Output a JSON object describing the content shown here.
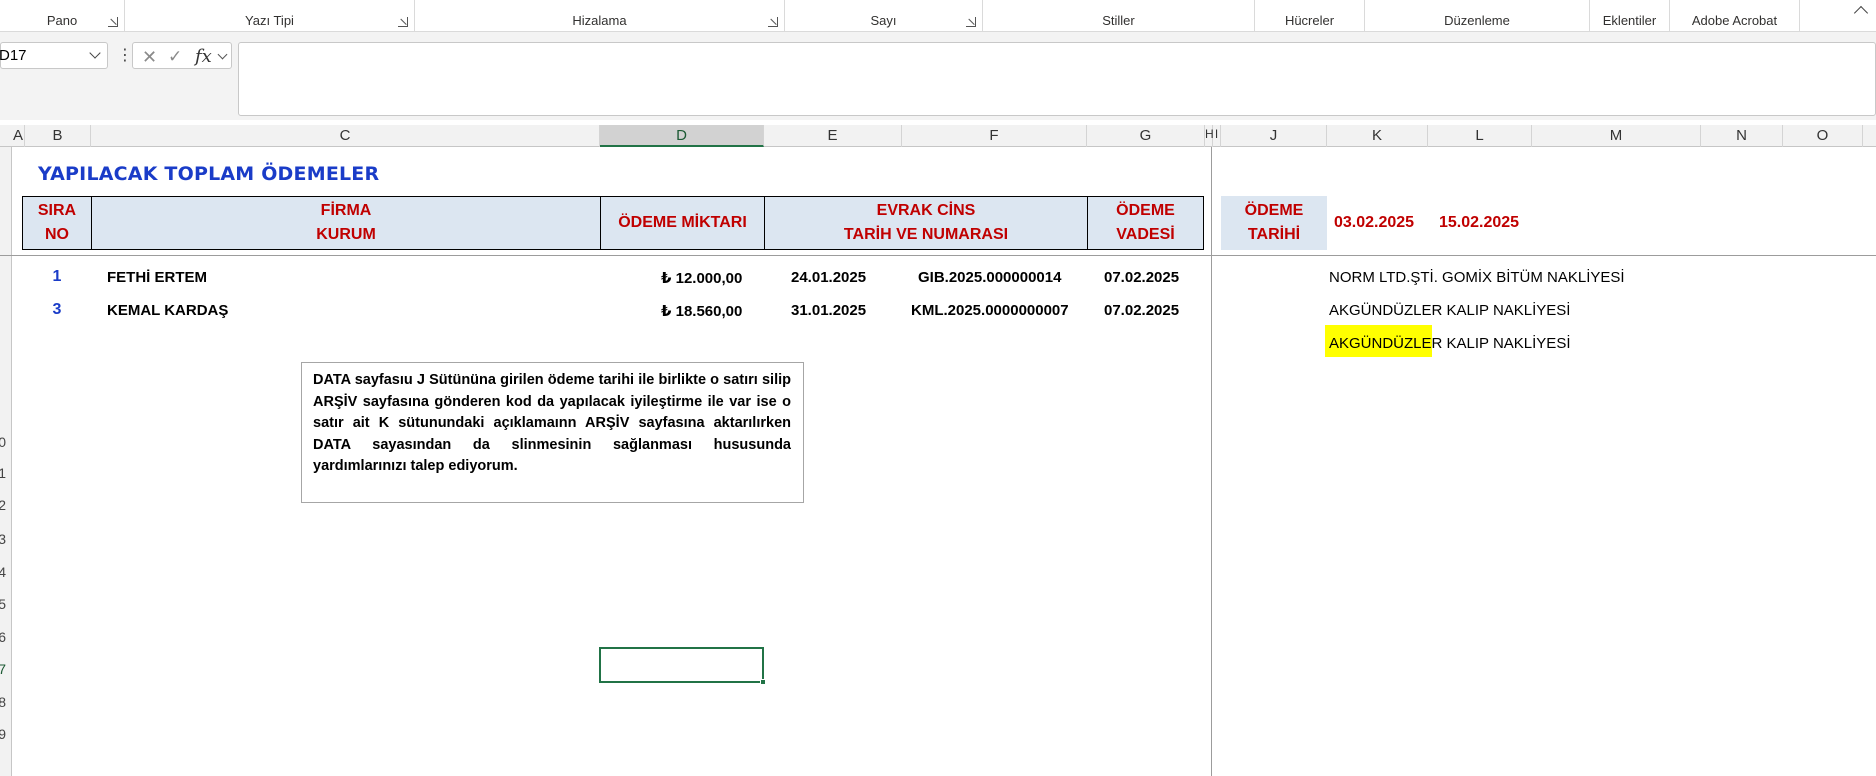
{
  "ribbon": {
    "groups": [
      {
        "label": "Pano"
      },
      {
        "label": "Yazı Tipi"
      },
      {
        "label": "Hizalama"
      },
      {
        "label": "Sayı"
      },
      {
        "label": "Stiller"
      },
      {
        "label": "Hücreler"
      },
      {
        "label": "Düzenleme"
      },
      {
        "label": "Eklentiler"
      },
      {
        "label": "Adobe Acrobat"
      }
    ]
  },
  "formula_bar": {
    "name_box": "D17",
    "fx_label": "fx",
    "formula": ""
  },
  "columns": [
    {
      "label": "A"
    },
    {
      "label": "B"
    },
    {
      "label": "C"
    },
    {
      "label": "D"
    },
    {
      "label": "E"
    },
    {
      "label": "F"
    },
    {
      "label": "G"
    },
    {
      "label": "H"
    },
    {
      "label": "I"
    },
    {
      "label": "J"
    },
    {
      "label": "K"
    },
    {
      "label": "L"
    },
    {
      "label": "M"
    },
    {
      "label": "N"
    },
    {
      "label": "O"
    }
  ],
  "rows": [
    "0",
    "1",
    "2",
    "3",
    "4",
    "5",
    "6",
    "7",
    "8",
    "9"
  ],
  "sheet": {
    "title": "YAPILACAK TOPLAM ÖDEMELER",
    "headers": {
      "sira_1": "SIRA",
      "sira_2": "NO",
      "firma_1": "FİRMA",
      "firma_2": "KURUM",
      "miktar": "ÖDEME MİKTARI",
      "evrak_1": "EVRAK CİNS",
      "evrak_2": "TARİH VE NUMARASI",
      "vade_1": "ÖDEME",
      "vade_2": "VADESİ"
    },
    "odeme_tarihi": {
      "label_1": "ÖDEME",
      "label_2": "TARİHİ",
      "date_1": "03.02.2025",
      "date_2": "15.02.2025"
    },
    "data_rows": [
      {
        "no": "1",
        "firma": "FETHİ ERTEM",
        "miktar": "₺ 12.000,00",
        "tarih": "24.01.2025",
        "evrak_no": "GIB.2025.000000014",
        "vade": "07.02.2025"
      },
      {
        "no": "3",
        "firma": "KEMAL KARDAŞ",
        "miktar": "₺ 18.560,00",
        "tarih": "31.01.2025",
        "evrak_no": "KML.2025.0000000007",
        "vade": "07.02.2025"
      }
    ],
    "notes": {
      "n1": "NORM LTD.ŞTİ.  GOMİX BİTÜM NAKLİYESİ",
      "n2": "AKGÜNDÜZLER KALIP NAKLİYESİ",
      "n3_highlight": "AKGÜNDÜZLE",
      "n3_rest": "R KALIP NAKLİYESİ"
    },
    "textbox": "DATA sayfasıu J Sütününa girilen ödeme tarihi ile birlikte o satırı silip ARŞİV sayfasına gönderen kod da yapılacak iyileştirme ile var ise o satır ait K sütunundaki açıklamaınn ARŞİV sayfasına aktarılırken DATA sayasından da slinmesinin sağlanması hususunda yardımlarınızı  talep ediyorum."
  },
  "colors": {
    "title_blue": "#1a3cc8",
    "header_red": "#c00000",
    "header_fill": "#dce6f1",
    "highlight": "#ffff00",
    "excel_green": "#217346"
  },
  "icons": [
    "dialog-launcher-icon",
    "chevron-down-icon",
    "more-options-icon",
    "cancel-icon",
    "confirm-icon",
    "ribbon-collapse-icon"
  ]
}
